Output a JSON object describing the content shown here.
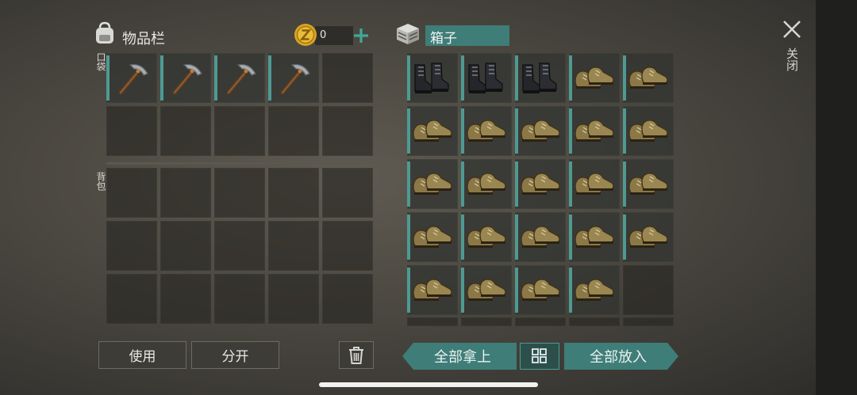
{
  "inventory": {
    "title": "物品栏",
    "coin_value": "0",
    "pocket_label": "口袋",
    "backpack_label": "背包",
    "pocket_items": [
      "pickaxe",
      "pickaxe",
      "pickaxe",
      "pickaxe",
      "",
      "",
      "",
      "",
      "",
      ""
    ],
    "backpack_items": [
      "",
      "",
      "",
      "",
      "",
      "",
      "",
      "",
      "",
      "",
      "",
      "",
      "",
      "",
      ""
    ]
  },
  "box": {
    "title": "箱子",
    "items": [
      "black-boots",
      "black-boots",
      "black-boots",
      "brown-shoes",
      "brown-shoes",
      "brown-shoes",
      "brown-shoes",
      "brown-shoes",
      "brown-shoes",
      "brown-shoes",
      "brown-shoes",
      "brown-shoes",
      "brown-shoes",
      "brown-shoes",
      "brown-shoes",
      "brown-shoes",
      "brown-shoes",
      "brown-shoes",
      "brown-shoes",
      "brown-shoes",
      "brown-shoes",
      "brown-shoes",
      "brown-shoes",
      "brown-shoes",
      ""
    ]
  },
  "actions": {
    "use": "使用",
    "split": "分开",
    "take_all": "全部拿上",
    "put_all": "全部放入",
    "close": "关闭"
  },
  "icons": {
    "backpack": "backpack-icon",
    "coin": "coin-icon",
    "add": "plus-icon",
    "box": "box-icon",
    "trash": "trash-icon",
    "sort": "sort-icon",
    "close": "close-icon"
  },
  "colors": {
    "accent_teal": "#3f7d78",
    "slot_marker": "#4e9a92",
    "coin": "#d9a520"
  }
}
